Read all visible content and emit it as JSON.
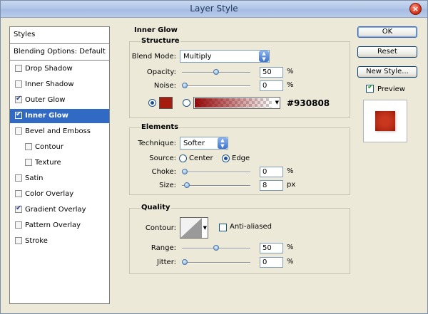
{
  "window": {
    "title": "Layer Style",
    "close_glyph": "×"
  },
  "left_panel": {
    "styles_label": "Styles",
    "blending_label": "Blending Options: Default",
    "items": [
      {
        "label": "Drop Shadow",
        "checked": false
      },
      {
        "label": "Inner Shadow",
        "checked": false
      },
      {
        "label": "Outer Glow",
        "checked": true
      },
      {
        "label": "Inner Glow",
        "checked": true,
        "selected": true
      },
      {
        "label": "Bevel and Emboss",
        "checked": false
      },
      {
        "label": "Contour",
        "checked": false
      },
      {
        "label": "Texture",
        "checked": false
      },
      {
        "label": "Satin",
        "checked": false
      },
      {
        "label": "Color Overlay",
        "checked": false
      },
      {
        "label": "Gradient Overlay",
        "checked": true
      },
      {
        "label": "Pattern Overlay",
        "checked": false
      },
      {
        "label": "Stroke",
        "checked": false
      }
    ]
  },
  "inner_glow": {
    "section_title": "Inner Glow",
    "structure": {
      "title": "Structure",
      "blend_mode_label": "Blend Mode:",
      "blend_mode_value": "Multiply",
      "opacity_label": "Opacity:",
      "opacity_value": "50",
      "opacity_level": 0.5,
      "noise_label": "Noise:",
      "noise_value": "0",
      "noise_level": 0,
      "percent": "%",
      "color_hex": "#930808",
      "swatch_color": "#a51d0f"
    },
    "elements": {
      "title": "Elements",
      "technique_label": "Technique:",
      "technique_value": "Softer",
      "source_label": "Source:",
      "source_center": "Center",
      "source_edge": "Edge",
      "choke_label": "Choke:",
      "choke_value": "0",
      "choke_level": 0,
      "size_label": "Size:",
      "size_value": "8",
      "size_unit": "px",
      "size_level": 0.03,
      "percent": "%"
    },
    "quality": {
      "title": "Quality",
      "contour_label": "Contour:",
      "anti_aliased_label": "Anti-aliased",
      "range_label": "Range:",
      "range_value": "50",
      "range_level": 0.5,
      "jitter_label": "Jitter:",
      "jitter_value": "0",
      "jitter_level": 0,
      "percent": "%"
    }
  },
  "right_panel": {
    "ok_label": "OK",
    "reset_label": "Reset",
    "new_style_label": "New Style...",
    "preview_label": "Preview",
    "preview_checked": true
  }
}
